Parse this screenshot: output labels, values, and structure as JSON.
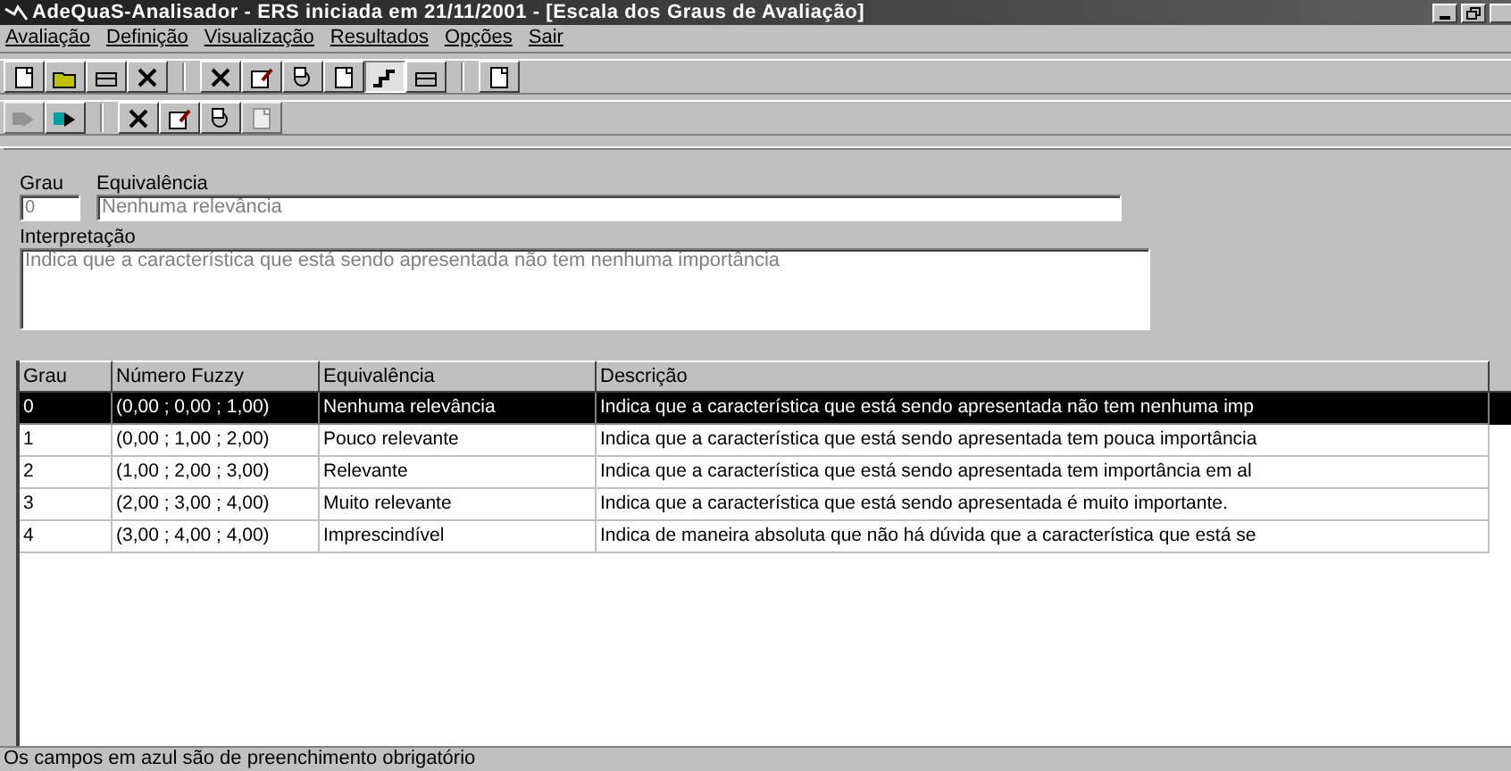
{
  "window": {
    "title": "AdeQuaS-Analisador - ERS iniciada em 21/11/2001 - [Escala dos Graus de Avaliação]"
  },
  "menu": [
    "Avaliação",
    "Definição",
    "Visualização",
    "Resultados",
    "Opções",
    "Sair"
  ],
  "toolbars": [
    [
      [
        {
          "pressed": false,
          "disabled": false
        },
        {
          "pressed": false,
          "disabled": false
        },
        {
          "pressed": false,
          "disabled": false
        },
        {
          "pressed": false,
          "disabled": false
        }
      ],
      [
        {
          "pressed": false,
          "disabled": false
        },
        {
          "pressed": false,
          "disabled": false
        },
        {
          "pressed": false,
          "disabled": false
        },
        {
          "pressed": false,
          "disabled": false
        },
        {
          "pressed": true,
          "disabled": false
        },
        {
          "pressed": false,
          "disabled": false
        }
      ],
      [
        {
          "pressed": false,
          "disabled": false
        }
      ]
    ],
    [
      [
        {
          "pressed": false,
          "disabled": true
        },
        {
          "pressed": false,
          "disabled": false
        }
      ],
      [
        {
          "pressed": false,
          "disabled": false
        },
        {
          "pressed": false,
          "disabled": false
        },
        {
          "pressed": false,
          "disabled": false
        },
        {
          "pressed": false,
          "disabled": true
        }
      ]
    ]
  ],
  "form": {
    "grau_label": "Grau",
    "grau_value": "0",
    "equivalencia_label": "Equivalência",
    "equivalencia_value": "Nenhuma relevância",
    "interpretacao_label": "Interpretação",
    "interpretacao_value": "Indica que a característica que está sendo apresentada não tem nenhuma importância"
  },
  "table": {
    "columns": [
      "Grau",
      "Número Fuzzy",
      "Equivalência",
      "Descrição"
    ],
    "rows": [
      {
        "selected": true,
        "cells": [
          "0",
          "(0,00 ; 0,00 ; 1,00)",
          "Nenhuma relevância",
          "Indica que a característica que está sendo apresentada não tem nenhuma imp"
        ]
      },
      {
        "selected": false,
        "cells": [
          "1",
          "(0,00 ; 1,00 ; 2,00)",
          "Pouco relevante",
          "Indica que a característica que está sendo apresentada tem pouca importância"
        ]
      },
      {
        "selected": false,
        "cells": [
          "2",
          "(1,00 ; 2,00 ; 3,00)",
          "Relevante",
          "Indica que a característica que está sendo apresentada tem importância em al"
        ]
      },
      {
        "selected": false,
        "cells": [
          "3",
          "(2,00 ; 3,00 ; 4,00)",
          "Muito relevante",
          "Indica que a característica que está sendo apresentada é muito importante."
        ]
      },
      {
        "selected": false,
        "cells": [
          "4",
          "(3,00 ; 4,00 ; 4,00)",
          "Imprescindível",
          "Indica de maneira absoluta que não há dúvida que a característica que está se"
        ]
      }
    ]
  },
  "status_bar": "Os campos em azul são de preenchimento obrigatório"
}
